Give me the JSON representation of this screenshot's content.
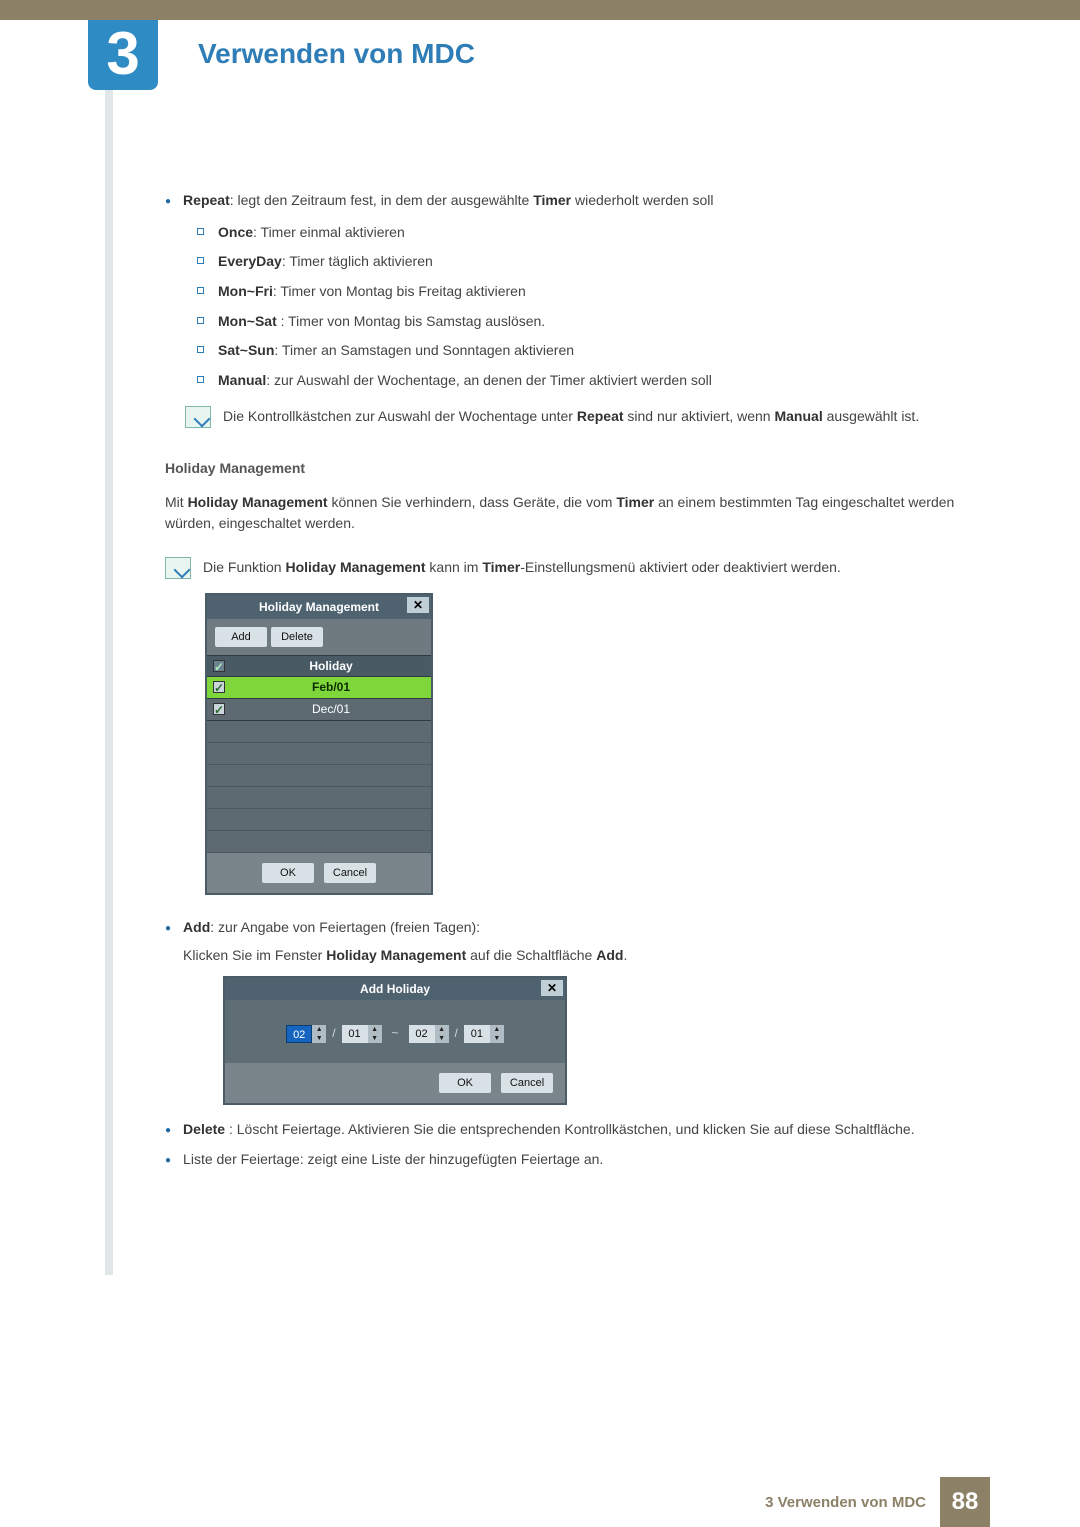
{
  "chapter": {
    "number": "3",
    "title": "Verwenden von MDC"
  },
  "repeat_intro": {
    "label": "Repeat",
    "text": ": legt den Zeitraum fest, in dem der ausgewählte ",
    "label2": "Timer",
    "tail": " wiederholt werden soll"
  },
  "repeat_options": [
    {
      "label": "Once",
      "text": ": Timer einmal aktivieren"
    },
    {
      "label": "EveryDay",
      "text": ": Timer täglich aktivieren"
    },
    {
      "label": "Mon~Fri",
      "text": ": Timer von Montag bis Freitag aktivieren"
    },
    {
      "label": "Mon~Sat",
      "text": " : Timer von Montag bis Samstag auslösen."
    },
    {
      "label": "Sat~Sun",
      "text": ": Timer an Samstagen und Sonntagen aktivieren"
    },
    {
      "label": "Manual",
      "text": ": zur Auswahl der Wochentage, an denen der Timer aktiviert werden soll"
    }
  ],
  "note_repeat": {
    "a": "Die Kontrollkästchen zur Auswahl der Wochentage unter ",
    "b": "Repeat",
    "c": " sind nur aktiviert, wenn ",
    "d": "Manual",
    "e": " ausgewählt ist."
  },
  "hm": {
    "heading": "Holiday Management",
    "p1a": "Mit ",
    "p1b": "Holiday Management",
    "p1c": " können Sie verhindern, dass Geräte, die vom ",
    "p1d": "Timer",
    "p1e": " an einem bestimmten Tag eingeschaltet werden würden, eingeschaltet werden.",
    "note_a": "Die Funktion ",
    "note_b": "Holiday Management",
    "note_c": " kann im ",
    "note_d": "Timer",
    "note_e": "-Einstellungsmenü aktiviert oder deaktiviert werden."
  },
  "dlg_hm": {
    "title": "Holiday Management",
    "add": "Add",
    "delete": "Delete",
    "col": "Holiday",
    "rows": [
      {
        "date": "Feb/01",
        "checked": true,
        "selected": true
      },
      {
        "date": "Dec/01",
        "checked": true,
        "selected": false
      }
    ],
    "ok": "OK",
    "cancel": "Cancel"
  },
  "add_item": {
    "label": "Add",
    "text": ": zur Angabe von Feiertagen (freien Tagen):"
  },
  "add_line2": {
    "a": "Klicken Sie im Fenster ",
    "b": "Holiday Management",
    "c": " auf die Schaltfläche ",
    "d": "Add",
    "e": "."
  },
  "dlg_add": {
    "title": "Add Holiday",
    "from_mm": "02",
    "from_dd": "01",
    "to_mm": "02",
    "to_dd": "01",
    "ok": "OK",
    "cancel": "Cancel"
  },
  "delete_item": {
    "label": "Delete",
    "text": " : Löscht Feiertage. Aktivieren Sie die entsprechenden Kontrollkästchen, und klicken Sie auf diese Schaltfläche."
  },
  "list_item": "Liste der Feiertage: zeigt eine Liste der hinzugefügten Feiertage an.",
  "footer": {
    "text": "3 Verwenden von MDC",
    "page": "88"
  }
}
